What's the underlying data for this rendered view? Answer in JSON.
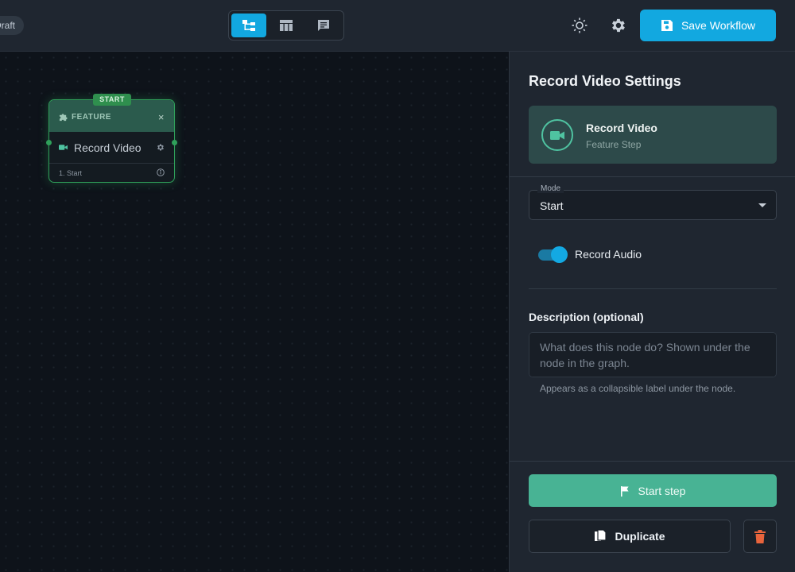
{
  "header": {
    "draft_label": "Draft",
    "view_modes": [
      {
        "name": "graph",
        "icon": "graph-view-icon",
        "active": true
      },
      {
        "name": "table",
        "icon": "table-view-icon",
        "active": false
      },
      {
        "name": "chat",
        "icon": "chat-view-icon",
        "active": false
      }
    ],
    "theme_icon": "sun-icon",
    "settings_icon": "gear-icon",
    "save_label": "Save Workflow",
    "accent_color": "#12a8e0"
  },
  "canvas": {
    "node": {
      "badge": "START",
      "type_label": "FEATURE",
      "close_glyph": "×",
      "title": "Record Video",
      "footer": "1. Start",
      "border_color": "#2fa05a"
    }
  },
  "panel": {
    "title": "Record Video Settings",
    "step_card": {
      "name": "Record Video",
      "subtitle": "Feature Step",
      "icon": "video-camera-icon"
    },
    "mode": {
      "label": "Mode",
      "value": "Start"
    },
    "record_audio": {
      "label": "Record Audio",
      "enabled": true
    },
    "description": {
      "label": "Description (optional)",
      "placeholder": "What does this node do? Shown under the node in the graph.",
      "value": "",
      "help": "Appears as a collapsible label under the node."
    },
    "start_step_label": "Start step",
    "duplicate_label": "Duplicate",
    "delete_icon": "trash-icon",
    "start_color": "#48b394",
    "delete_color": "#e8643c"
  }
}
